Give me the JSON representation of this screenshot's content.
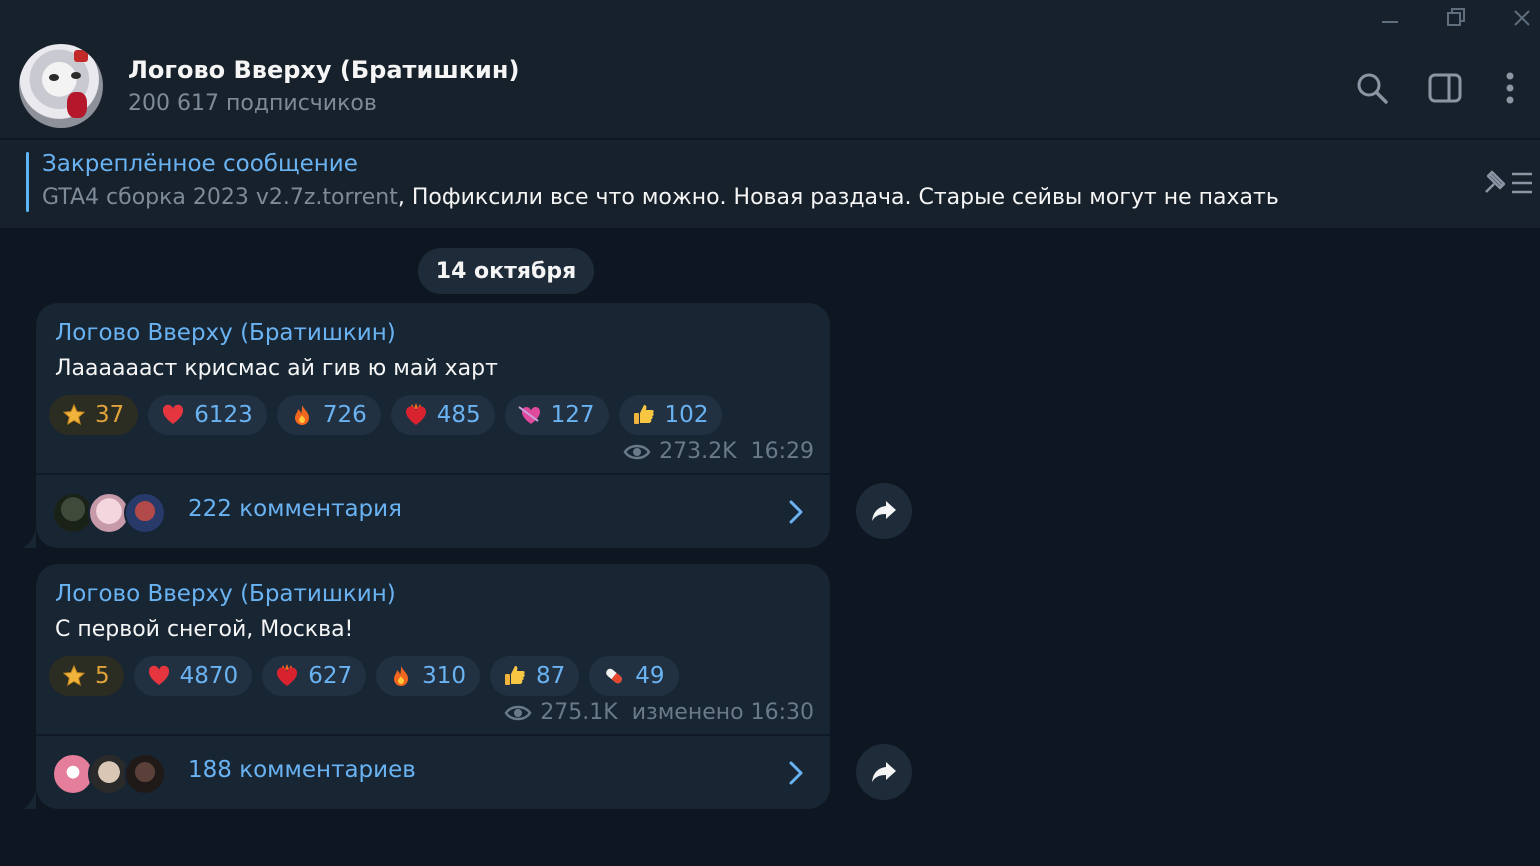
{
  "window": {
    "controls": [
      "minimize-icon",
      "restore-icon",
      "close-icon"
    ]
  },
  "header": {
    "title": "Логово Вверху (Братишкин)",
    "subtitle": "200 617 подписчиков",
    "icons": [
      "search-icon",
      "sidebar-toggle-icon",
      "more-vertical-icon"
    ]
  },
  "pinned": {
    "title": "Закреплённое сообщение",
    "file": "GTA4 сборка 2023 v2.7z.torrent",
    "text": ", Пофиксили все что можно. Новая раздача.  Старые сейвы могут не пахать"
  },
  "date_separator": "14 октября",
  "messages": [
    {
      "author": "Логово Вверху (Братишкин)",
      "text": "Лааааааст крисмас ай гив ю май харт",
      "reactions": [
        {
          "emoji": "star",
          "count": "37"
        },
        {
          "emoji": "heart",
          "count": "6123"
        },
        {
          "emoji": "fire",
          "count": "726"
        },
        {
          "emoji": "heart-on-fire",
          "count": "485"
        },
        {
          "emoji": "heart-with-arrow",
          "count": "127"
        },
        {
          "emoji": "thumbs-up",
          "count": "102"
        }
      ],
      "views": "273.2K",
      "time": "16:29",
      "comments": "222 комментария"
    },
    {
      "author": "Логово Вверху (Братишкин)",
      "text": "С первой снегой, Москва!",
      "reactions": [
        {
          "emoji": "star",
          "count": "5"
        },
        {
          "emoji": "heart",
          "count": "4870"
        },
        {
          "emoji": "heart-on-fire",
          "count": "627"
        },
        {
          "emoji": "fire",
          "count": "310"
        },
        {
          "emoji": "thumbs-up",
          "count": "87"
        },
        {
          "emoji": "pill",
          "count": "49"
        }
      ],
      "views": "275.1K",
      "time": "изменено 16:30",
      "comments": "188 комментариев"
    }
  ],
  "colors": {
    "background": "#0e1621",
    "panel": "#17212b",
    "bubble": "#182533",
    "accent": "#6ab3f3",
    "muted": "#6b7a89"
  }
}
